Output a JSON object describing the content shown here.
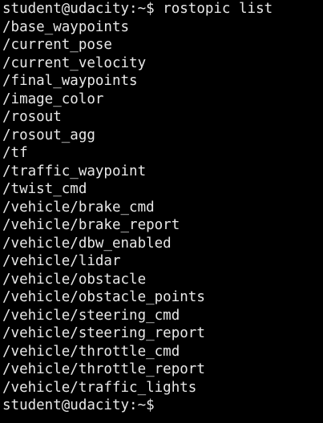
{
  "terminal": {
    "colors": {
      "background": "#000000",
      "foreground": "#e8e8e8"
    },
    "command_prompt": "student@udacity:~$ rostopic list",
    "output": [
      "/base_waypoints",
      "/current_pose",
      "/current_velocity",
      "/final_waypoints",
      "/image_color",
      "/rosout",
      "/rosout_agg",
      "/tf",
      "/traffic_waypoint",
      "/twist_cmd",
      "/vehicle/brake_cmd",
      "/vehicle/brake_report",
      "/vehicle/dbw_enabled",
      "/vehicle/lidar",
      "/vehicle/obstacle",
      "/vehicle/obstacle_points",
      "/vehicle/steering_cmd",
      "/vehicle/steering_report",
      "/vehicle/throttle_cmd",
      "/vehicle/throttle_report",
      "/vehicle/traffic_lights"
    ],
    "final_prompt": "student@udacity:~$"
  }
}
